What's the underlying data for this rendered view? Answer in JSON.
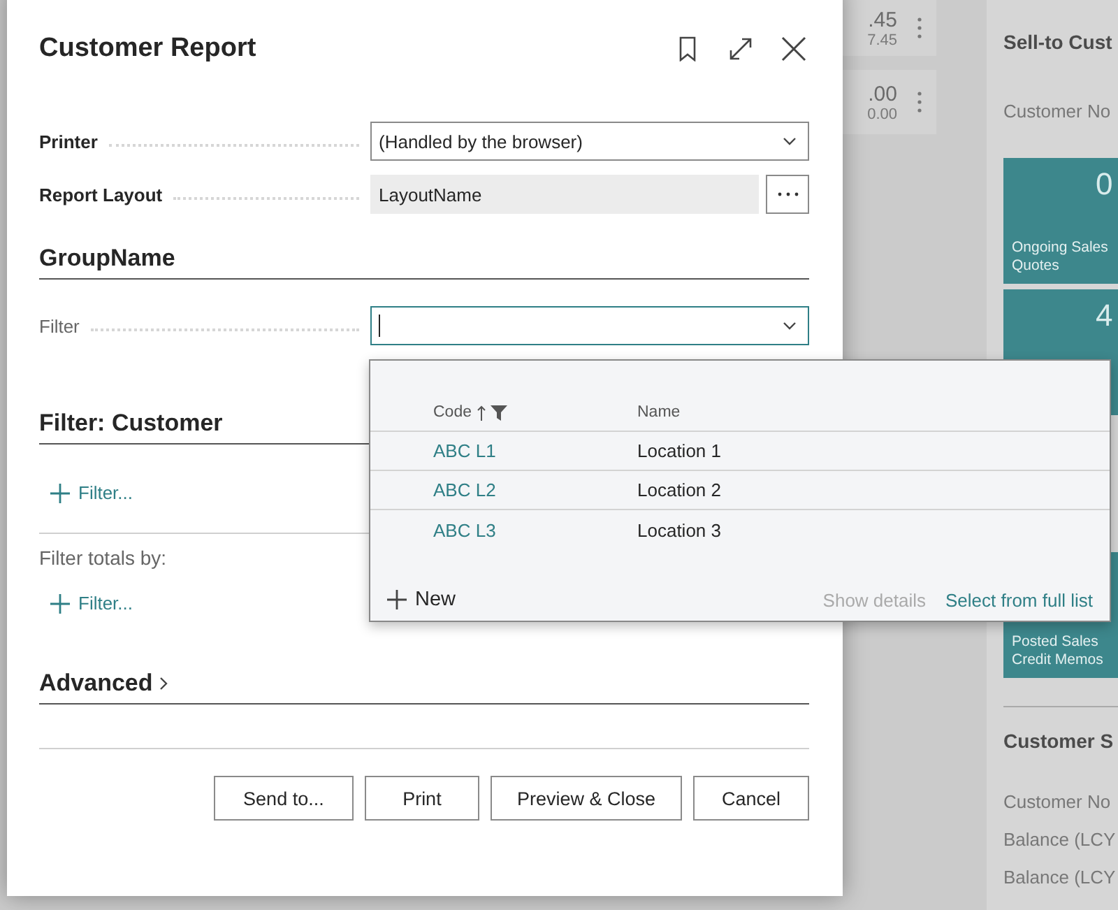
{
  "background": {
    "cards": [
      {
        "amount": ".45",
        "subamount": "7.45"
      },
      {
        "amount": ".00",
        "subamount": "0.00"
      }
    ],
    "panel": {
      "title": "Sell-to Cust",
      "field": "Customer No",
      "tiles": [
        {
          "value": "0",
          "label": "Ongoing Sales Quotes"
        },
        {
          "value": "4"
        },
        {
          "label": "Posted Sales Credit Memos"
        }
      ],
      "section": "Customer S",
      "rows": [
        "Customer No",
        "Balance (LCY",
        "Balance (LCY"
      ]
    }
  },
  "dialog": {
    "title": "Customer Report",
    "fields": [
      {
        "label": "Printer",
        "kind": "select",
        "value": "(Handled by the browser)",
        "emphasized": true
      },
      {
        "label": "Report Layout",
        "kind": "lookup",
        "value": "LayoutName",
        "emphasized": true
      }
    ],
    "group": {
      "title": "GroupName",
      "fields": [
        {
          "label": "Filter",
          "kind": "combo",
          "focused": true,
          "emphasized": false
        }
      ]
    },
    "filter_section": {
      "title": "Filter: Customer",
      "add_filter": "Filter...",
      "totals_label": "Filter totals by:",
      "add_totals_filter": "Filter..."
    },
    "advanced": {
      "title": "Advanced",
      "expanded": false
    },
    "buttons": [
      "Send to...",
      "Print",
      "Preview & Close",
      "Cancel"
    ]
  },
  "dropdown": {
    "columns": [
      {
        "label": "Code",
        "sorted": true,
        "filtered": true
      },
      {
        "label": "Name",
        "sorted": false,
        "filtered": false
      }
    ],
    "rows": [
      {
        "code": "ABC L1",
        "name": "Location 1"
      },
      {
        "code": "ABC L2",
        "name": "Location 2"
      },
      {
        "code": "ABC L3",
        "name": "Location 3"
      }
    ],
    "new": "New",
    "actions": [
      {
        "label": "Show details",
        "disabled": true
      },
      {
        "label": "Select from full list",
        "disabled": false
      }
    ]
  }
}
